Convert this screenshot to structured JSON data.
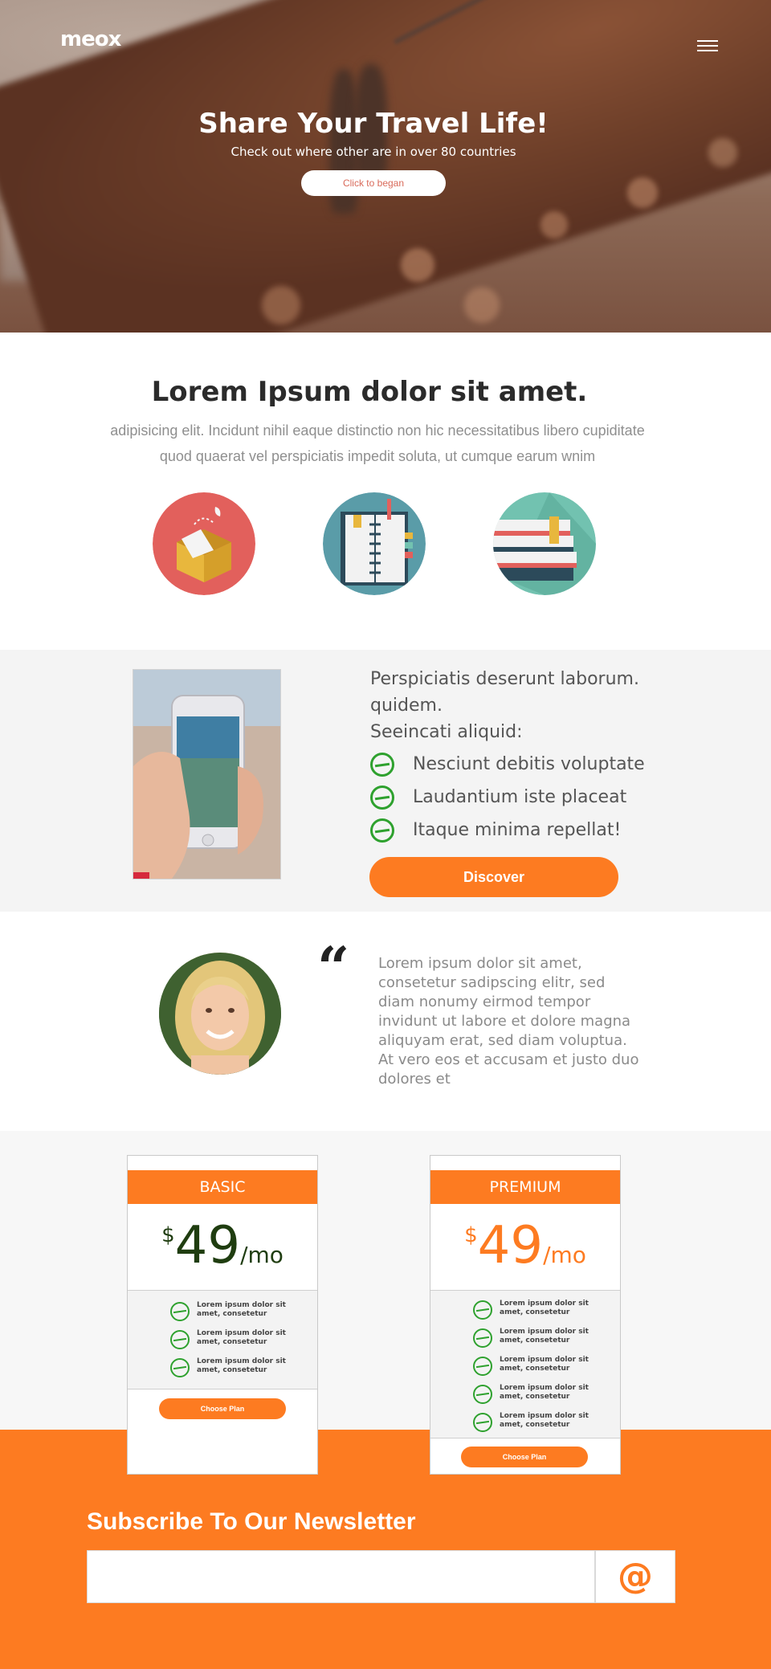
{
  "header": {
    "logo": "meox",
    "menu_icon": "hamburger-menu-icon"
  },
  "hero": {
    "title": "Share Your Travel Life!",
    "subtitle": "Check out where other are in over 80 countries",
    "cta_label": "Click to began"
  },
  "intro": {
    "title": "Lorem Ipsum dolor sit amet.",
    "text": "adipisicing elit. Incidunt nihil eaque distinctio non hic necessitatibus libero cupiditate quod quaerat vel perspiciatis impedit soluta, ut cumque earum wnim",
    "icons": [
      "open-box-icon",
      "notebook-icon",
      "books-icon"
    ]
  },
  "feature": {
    "heading_line1": "Perspiciatis deserunt laborum.",
    "heading_line2": "quidem.",
    "heading_line3": "Seeincati aliquid:",
    "items": [
      "Nesciunt debitis voluptate",
      "Laudantium iste placeat",
      "Itaque minima repellat!"
    ],
    "button_label": "Discover"
  },
  "testimonial": {
    "quote_mark": "“",
    "text": "Lorem ipsum dolor sit amet, consetetur sadipscing elitr, sed diam nonumy eirmod tempor invidunt ut labore et dolore magna aliquyam erat, sed diam voluptua. At vero eos et accusam et justo duo dolores et"
  },
  "pricing": {
    "plans": [
      {
        "name": "BASIC",
        "currency": "$",
        "amount": "49",
        "period": "/mo",
        "features": [
          "Lorem ipsum dolor sit amet, consetetur",
          "Lorem ipsum dolor sit amet, consetetur",
          "Lorem ipsum dolor sit amet, consetetur"
        ],
        "button_label": "Choose Plan"
      },
      {
        "name": "PREMIUM",
        "currency": "$",
        "amount": "49",
        "period": "/mo",
        "features": [
          "Lorem ipsum dolor sit amet, consetetur",
          "Lorem ipsum dolor sit amet, consetetur",
          "Lorem ipsum dolor sit amet, consetetur",
          "Lorem ipsum dolor sit amet, consetetur",
          "Lorem ipsum dolor sit amet, consetetur"
        ],
        "button_label": "Choose Plan"
      }
    ]
  },
  "newsletter": {
    "title": "Subscribe To Our Newsletter",
    "input_value": "",
    "at_symbol": "@"
  },
  "colors": {
    "accent": "#fd7b21",
    "check_green": "#2ea12e",
    "basic_price": "#1f3d10",
    "premium_price": "#fd7b21"
  }
}
